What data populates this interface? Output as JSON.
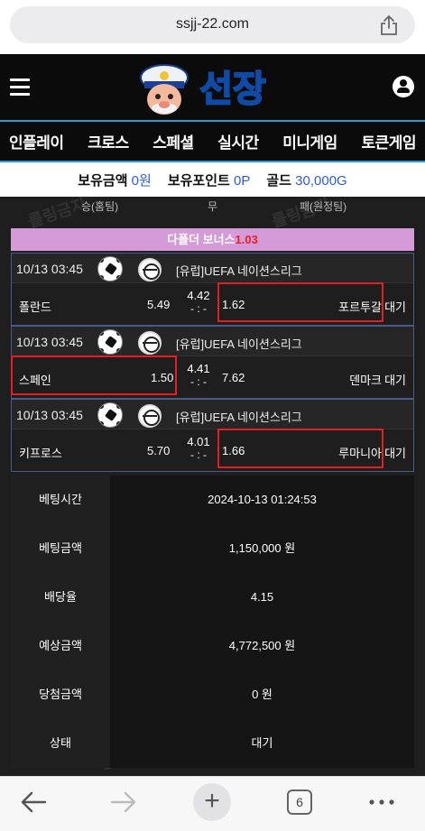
{
  "browser": {
    "url": "ssjj-22.com",
    "tab_count": "6"
  },
  "header": {
    "logo_text": "선장"
  },
  "nav": {
    "items": [
      "인플레이",
      "크로스",
      "스페셜",
      "실시간",
      "미니게임",
      "토큰게임"
    ]
  },
  "balance": {
    "money_label": "보유금액",
    "money_value": "0원",
    "points_label": "보유포인트",
    "points_value": "0P",
    "gold_label": "골드",
    "gold_value": "30,000G"
  },
  "columns": {
    "home": "승(홈팀)",
    "draw": "무",
    "away": "패(원정팀)"
  },
  "bonus": {
    "label": "다폴더 보너스",
    "rate": "1.03"
  },
  "matches": [
    {
      "time": "10/13 03:45",
      "league": "[유럽]UEFA 네이션스리그",
      "home": "폴란드",
      "home_odds": "5.49",
      "draw_odds": "4.42",
      "score": "- : -",
      "away_odds": "1.62",
      "away": "포르투갈",
      "status": "대기",
      "selected": "away"
    },
    {
      "time": "10/13 03:45",
      "league": "[유럽]UEFA 네이션스리그",
      "home": "스페인",
      "home_odds": "1.50",
      "draw_odds": "4.41",
      "score": "- : -",
      "away_odds": "7.62",
      "away": "덴마크",
      "status": "대기",
      "selected": "home"
    },
    {
      "time": "10/13 03:45",
      "league": "[유럽]UEFA 네이션스리그",
      "home": "키프로스",
      "home_odds": "5.70",
      "draw_odds": "4.01",
      "score": "- : -",
      "away_odds": "1.66",
      "away": "루마니아",
      "status": "대기",
      "selected": "away"
    }
  ],
  "details": [
    {
      "label": "베팅시간",
      "value": "2024-10-13 01:24:53"
    },
    {
      "label": "베팅금액",
      "value": "1,150,000 원"
    },
    {
      "label": "배당율",
      "value": "4.15"
    },
    {
      "label": "예상금액",
      "value": "4,772,500 원"
    },
    {
      "label": "당첨금액",
      "value": "0 원"
    },
    {
      "label": "상태",
      "value": "대기"
    }
  ],
  "watermark_text": "롤링금지",
  "colors": {
    "accent_blue": "#2a9ad8",
    "selection_red": "#e41e25",
    "bonus_bg": "#d59ad8",
    "balance_value": "#2d5be0"
  },
  "icons": [
    "share-icon",
    "hamburger-icon",
    "user-icon",
    "soccer-ball-icon",
    "globe-icon",
    "back-icon",
    "forward-icon",
    "plus-icon",
    "tabs-icon",
    "more-icon"
  ]
}
